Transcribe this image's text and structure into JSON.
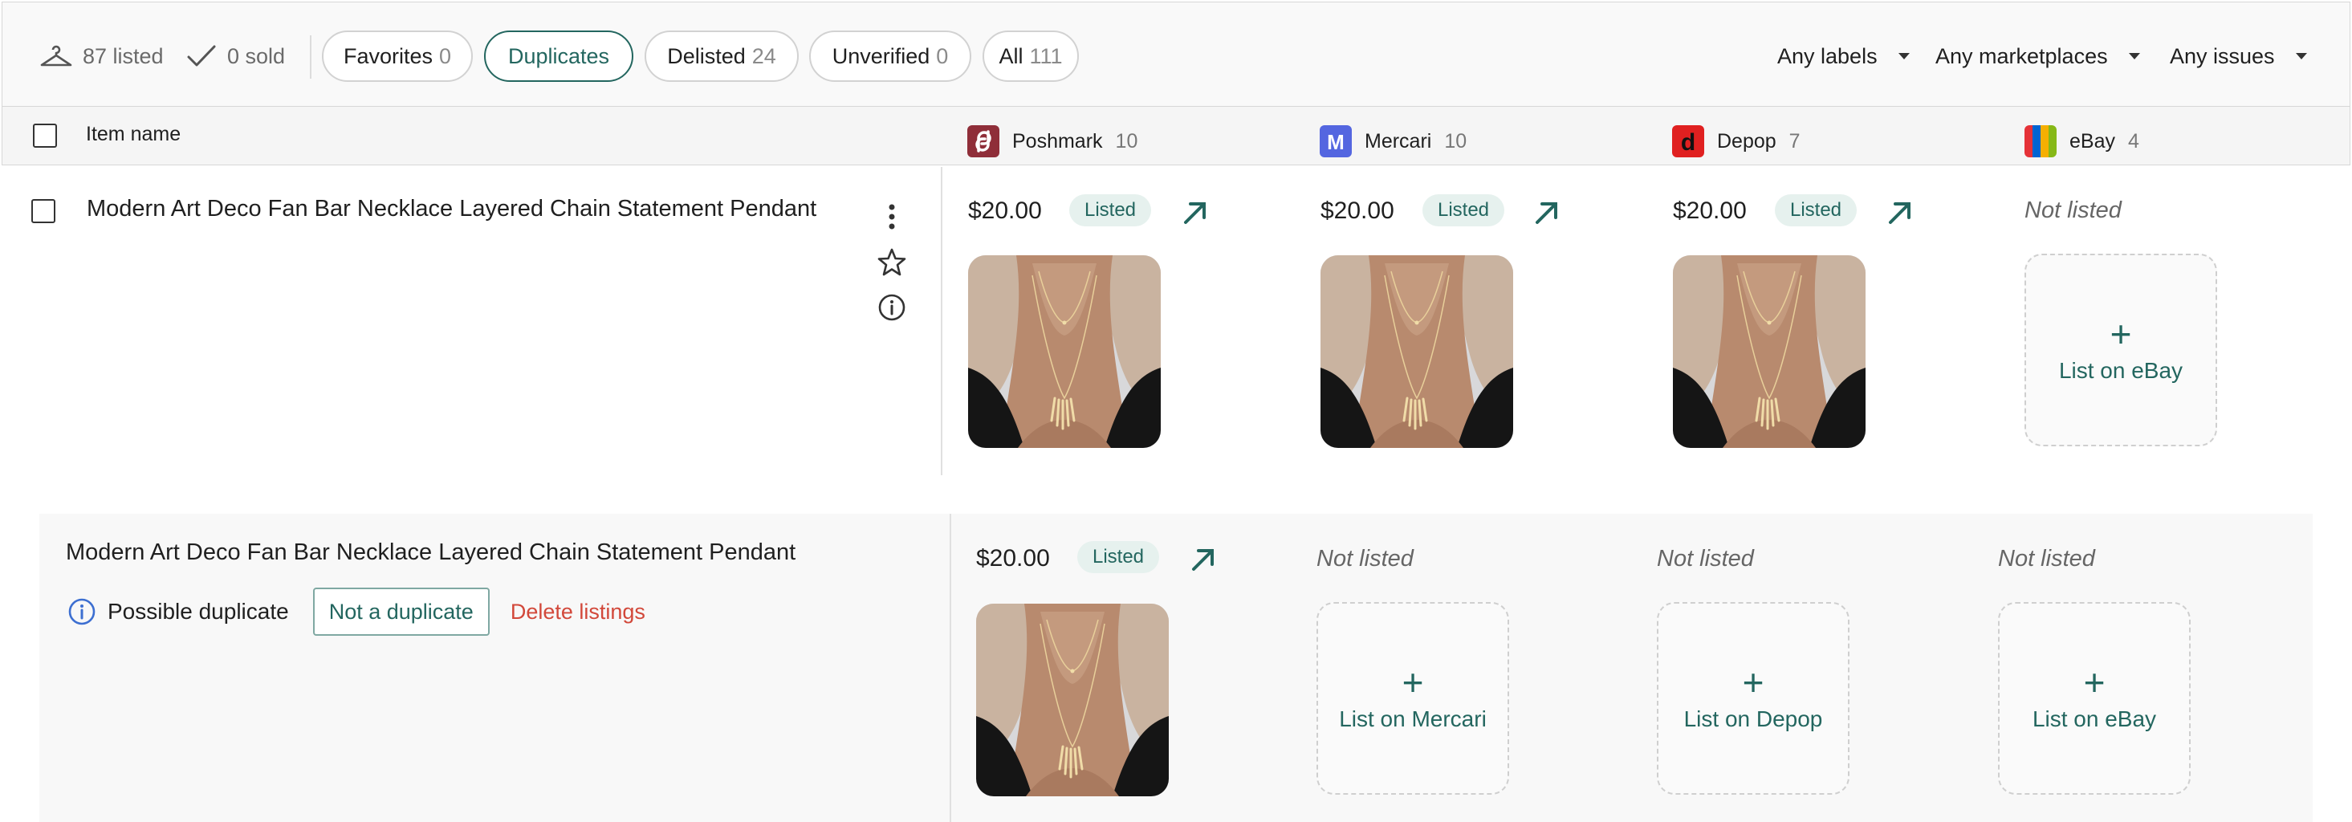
{
  "toolbar": {
    "listed": "87 listed",
    "sold": "0 sold",
    "filters": [
      {
        "label": "Favorites",
        "count": "0"
      },
      {
        "label": "Duplicates",
        "count": ""
      },
      {
        "label": "Delisted",
        "count": "24"
      },
      {
        "label": "Unverified",
        "count": "0"
      },
      {
        "label": "All",
        "count": "111"
      }
    ],
    "active_filter": "Duplicates",
    "dropdowns": {
      "labels": "Any labels",
      "marketplaces": "Any marketplaces",
      "issues": "Any issues"
    }
  },
  "table": {
    "item_name_header": "Item name",
    "marketplaces": [
      {
        "name": "Poshmark",
        "count": "10",
        "logo_color": "#8f2e39",
        "logo_letter": "P"
      },
      {
        "name": "Mercari",
        "count": "10",
        "logo_color": "#5466e0",
        "logo_letter": "M"
      },
      {
        "name": "Depop",
        "count": "7",
        "logo_color": "#e02020",
        "logo_letter": "d"
      },
      {
        "name": "eBay",
        "count": "4",
        "logo_colors": [
          "#e53238",
          "#0064d2",
          "#f5af02",
          "#86b817"
        ]
      }
    ]
  },
  "row": {
    "title": "Modern Art Deco Fan Bar Necklace Layered Chain Statement Pendant",
    "poshmark": {
      "price": "$20.00",
      "status": "Listed"
    },
    "mercari": {
      "price": "$20.00",
      "status": "Listed"
    },
    "depop": {
      "price": "$20.00",
      "status": "Listed"
    },
    "ebay": {
      "status": "Not listed",
      "action": "List on eBay"
    }
  },
  "duplicate": {
    "title": "Modern Art Deco Fan Bar Necklace Layered Chain Statement Pendant",
    "notice": "Possible duplicate",
    "not_duplicate_btn": "Not a duplicate",
    "delete_btn": "Delete listings",
    "poshmark": {
      "price": "$20.00",
      "status": "Listed"
    },
    "mercari": {
      "status": "Not listed",
      "action": "List on Mercari"
    },
    "depop": {
      "status": "Not listed",
      "action": "List on Depop"
    },
    "ebay": {
      "status": "Not listed",
      "action": "List on eBay"
    }
  },
  "colors": {
    "accent": "#23665f",
    "badge_bg": "#e6f1ee",
    "danger": "#d2483a",
    "info": "#3d6fd1"
  }
}
